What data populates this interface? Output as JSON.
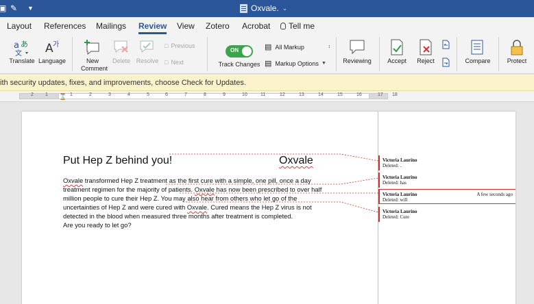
{
  "window": {
    "title": "Oxvale.",
    "quick_access": [
      "save-icon",
      "edit-icon",
      "customize-icon"
    ]
  },
  "tabs": [
    {
      "label": "Layout"
    },
    {
      "label": "References"
    },
    {
      "label": "Mailings"
    },
    {
      "label": "Review",
      "active": true
    },
    {
      "label": "View"
    },
    {
      "label": "Zotero"
    },
    {
      "label": "Acrobat"
    },
    {
      "label": "Tell me"
    }
  ],
  "ribbon": {
    "translate": "Translate",
    "language": "Language",
    "new_comment": "New Comment",
    "delete": "Delete",
    "resolve": "Resolve",
    "previous": "Previous",
    "next": "Next",
    "track_toggle": "ON",
    "track_changes": "Track Changes",
    "markup_view": "All Markup",
    "markup_options": "Markup Options",
    "reviewing": "Reviewing",
    "accept": "Accept",
    "reject": "Reject",
    "compare": "Compare",
    "protect": "Protect"
  },
  "message_bar": {
    "text": "ith security updates, fixes, and improvements, choose Check for Updates."
  },
  "ruler": {
    "numbers": [
      "2",
      "1",
      "1",
      "2",
      "3",
      "4",
      "5",
      "6",
      "7",
      "8",
      "9",
      "10",
      "11",
      "12",
      "13",
      "14",
      "15",
      "16",
      "17",
      "18"
    ]
  },
  "document": {
    "heading": "Put Hep Z behind you!",
    "brand": "Oxvale",
    "lines": [
      [
        {
          "t": "Oxvale",
          "sq": true
        },
        {
          "t": " transformed Hep Z treatment as the first cure with a simple, one pill, once a day"
        }
      ],
      [
        {
          "t": "treatment regimen for the majority of patients. "
        },
        {
          "t": "Oxvale",
          "sq": true
        },
        {
          "t": " has now been prescribed to over half"
        }
      ],
      [
        {
          "t": "million people to cure their Hep Z.  You may also hear from others who let go of the"
        }
      ],
      [
        {
          "t": "uncertainties of Hep Z and were cured with "
        },
        {
          "t": "Oxvale",
          "sq": true
        },
        {
          "t": ". Cured means the Hep Z virus is not"
        }
      ],
      [
        {
          "t": "detected in the blood when measured three months after treatment is completed."
        }
      ],
      [
        {
          "t": "Are you ready to let go?"
        }
      ]
    ]
  },
  "comments": [
    {
      "author": "Victoria Laurino",
      "text": "Deleted: .",
      "stamp": ""
    },
    {
      "author": "Victoria Laurino",
      "text": "Deleted: has",
      "stamp": ""
    },
    {
      "author": "Victoria Laurino",
      "text": "Deleted: will",
      "stamp": "A few seconds ago"
    },
    {
      "author": "Victoria Laurino",
      "text": "Deleted: Cure",
      "stamp": ""
    }
  ],
  "colors": {
    "brand": "#2b579a",
    "track_on": "#3aa54a",
    "revision": "#d42f2f"
  }
}
